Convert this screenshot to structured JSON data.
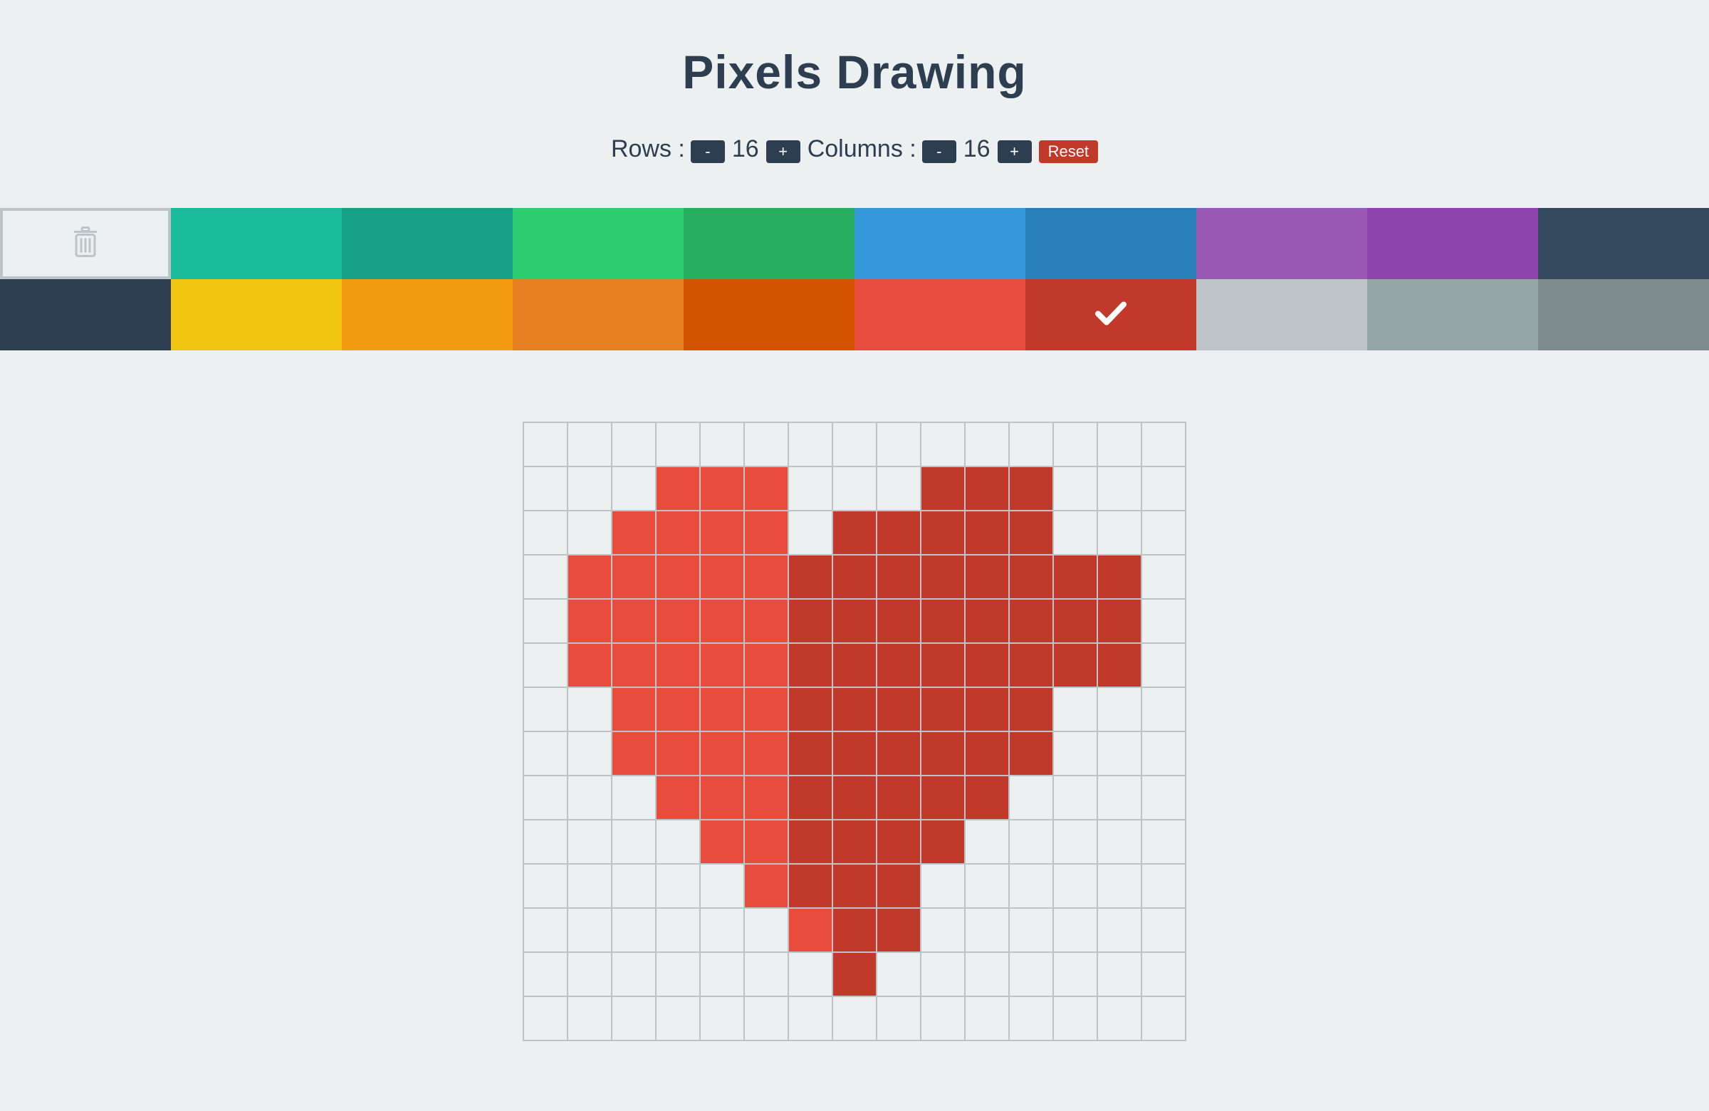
{
  "title": "Pixels Drawing",
  "controls": {
    "rows_label": "Rows :",
    "rows_value": "16",
    "columns_label": "Columns :",
    "columns_value": "16",
    "minus": "-",
    "plus": "+",
    "reset": "Reset"
  },
  "palette": {
    "selected_index": 15,
    "swatches": [
      {
        "name": "eraser",
        "color": "#ecf0f1",
        "icon": "trash-icon"
      },
      {
        "name": "turquoise",
        "color": "#1abc9c"
      },
      {
        "name": "green-sea",
        "color": "#16a085"
      },
      {
        "name": "emerald",
        "color": "#2ecc71"
      },
      {
        "name": "nephritis",
        "color": "#27ae60"
      },
      {
        "name": "peter-river",
        "color": "#3498db"
      },
      {
        "name": "belize-hole",
        "color": "#2980b9"
      },
      {
        "name": "amethyst",
        "color": "#9b59b6"
      },
      {
        "name": "wisteria",
        "color": "#8e44ad"
      },
      {
        "name": "wet-asphalt",
        "color": "#34495e"
      },
      {
        "name": "midnight-blue",
        "color": "#2c3e50"
      },
      {
        "name": "sunflower",
        "color": "#f1c40f"
      },
      {
        "name": "orange",
        "color": "#f39c12"
      },
      {
        "name": "carrot",
        "color": "#e67e22"
      },
      {
        "name": "pumpkin",
        "color": "#d35400"
      },
      {
        "name": "alizarin",
        "color": "#e74c3c"
      },
      {
        "name": "pomegranate",
        "color": "#c0392b",
        "icon": "check-icon"
      },
      {
        "name": "silver",
        "color": "#bdc3c7"
      },
      {
        "name": "concrete",
        "color": "#95a5a6"
      },
      {
        "name": "asbestos",
        "color": "#7f8c8d"
      }
    ]
  },
  "canvas": {
    "columns": 15,
    "rows": 14,
    "legend": {
      ".": "#ecf0f1",
      "a": "#e74c3c",
      "p": "#c0392b"
    },
    "pixels": [
      "...............",
      "...aaa...ppp...",
      "..aaaa.ppppp...",
      ".aaaaapppppppp.",
      ".aaaaapppppppp.",
      ".aaaaapppppppp.",
      "..aaaapppppp...",
      "..aaaapppppp...",
      "...aaappppp....",
      "....aapppp.....",
      ".....appp......",
      "......app......",
      ".......p.......",
      "..............."
    ]
  }
}
